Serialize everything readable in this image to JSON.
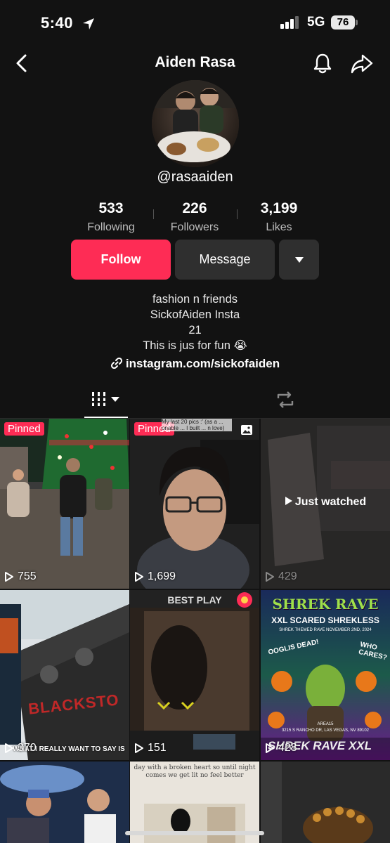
{
  "status": {
    "time": "5:40",
    "network": "5G",
    "battery": "76"
  },
  "header": {
    "title": "Aiden Rasa"
  },
  "profile": {
    "handle": "@rasaaiden",
    "stats": [
      {
        "value": "533",
        "label": "Following"
      },
      {
        "value": "226",
        "label": "Followers"
      },
      {
        "value": "3,199",
        "label": "Likes"
      }
    ],
    "follow_label": "Follow",
    "message_label": "Message",
    "bio": [
      "fashion n friends",
      "SickofAiden Insta",
      "21",
      "This is jus for fun 😭"
    ],
    "link": "instagram.com/sickofaiden"
  },
  "videos": [
    {
      "pinned": "Pinned",
      "views": "755"
    },
    {
      "pinned": "Pinned",
      "views": "1,699",
      "caption": "My last 20 pics :' (as a ... onable ... I built ... n love)"
    },
    {
      "views": "429",
      "overlay": "Just watched"
    },
    {
      "views": "370",
      "caption": "WHAT I REALLY WANT TO SAY IS",
      "brand": "BLACKSTO"
    },
    {
      "views": "151",
      "caption": "BEST PLAY"
    },
    {
      "views": "428",
      "title": "SHREK RAVE",
      "subtitle": "XXL SCARED SHREKLESS",
      "line": "SHREK THEMED RAVE NOVEMBER 2ND, 2024",
      "left": "OOGLIS DEAD!",
      "right": "WHO CARES?",
      "venue": "AREA15",
      "address": "3215 S RANCHO DR, LAS VEGAS, NV 89102",
      "footer": "SHREK RAVE XXL"
    },
    {
      "views": ""
    },
    {
      "views": "",
      "caption": "day with a broken heart so until night comes we get lit no feel better"
    },
    {
      "views": ""
    }
  ]
}
